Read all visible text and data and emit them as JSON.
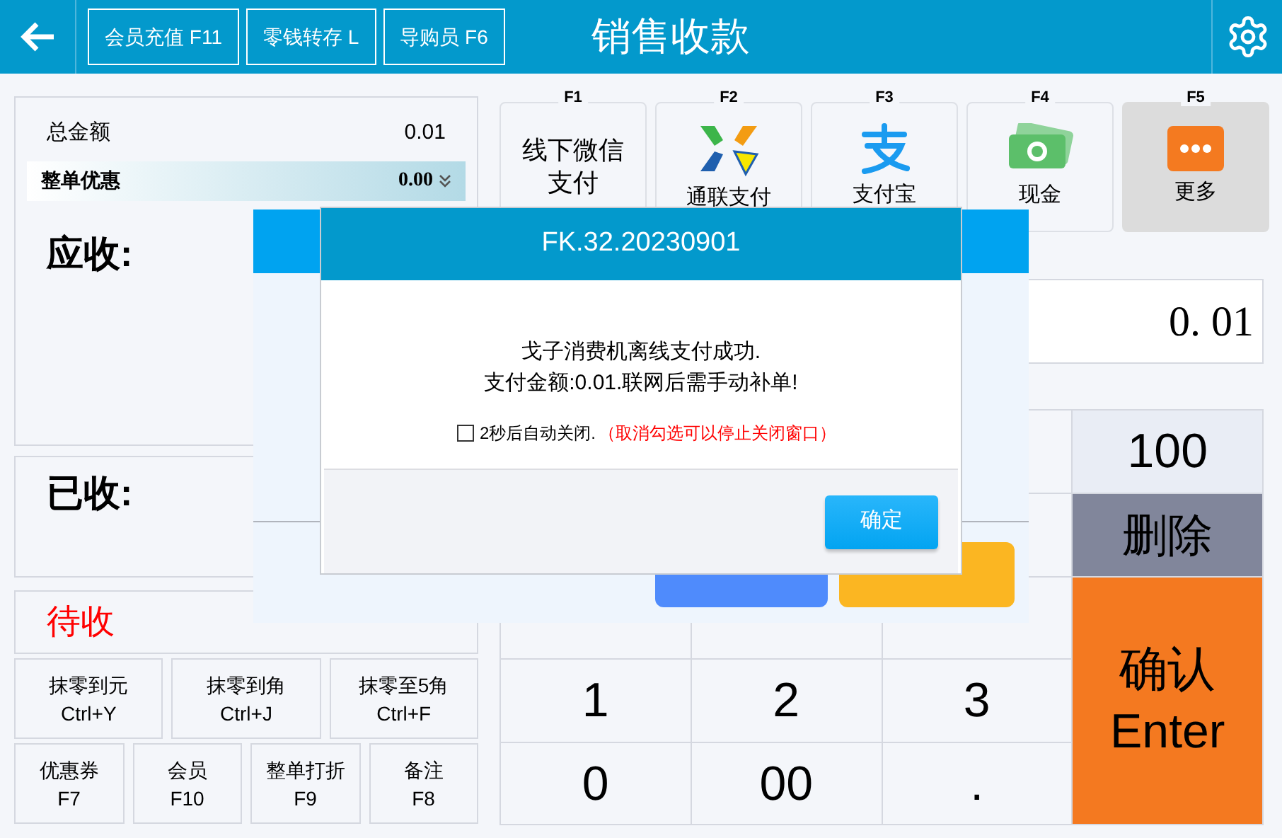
{
  "top_bar": {
    "buttons": [
      "会员充值 F11",
      "零钱转存 L",
      "导购员 F6"
    ],
    "title": "销售收款"
  },
  "summary": {
    "total_label": "总金额",
    "total_value": "0.01",
    "discount_label": "整单优惠",
    "discount_value": "0.00",
    "receivable_label": "应收:",
    "received_label": "已收:",
    "pending_label": "待收"
  },
  "rounding_buttons": [
    {
      "label": "抹零到元",
      "key": "Ctrl+Y"
    },
    {
      "label": "抹零到角",
      "key": "Ctrl+J"
    },
    {
      "label": "抹零至5角",
      "key": "Ctrl+F"
    }
  ],
  "function_buttons": [
    {
      "label": "优惠券",
      "key": "F7"
    },
    {
      "label": "会员",
      "key": "F10"
    },
    {
      "label": "整单打折",
      "key": "F9"
    },
    {
      "label": "备注",
      "key": "F8"
    }
  ],
  "payment_methods": [
    {
      "key": "F1",
      "label": "线下微信支付",
      "kind": "text",
      "selected": false
    },
    {
      "key": "F2",
      "label": "通联支付",
      "kind": "arrows",
      "selected": false
    },
    {
      "key": "F3",
      "label": "支付宝",
      "kind": "alipay",
      "selected": false
    },
    {
      "key": "F4",
      "label": "现金",
      "kind": "cash",
      "selected": false
    },
    {
      "key": "F5",
      "label": "更多",
      "kind": "more",
      "selected": true
    }
  ],
  "amount_field": {
    "value": "0. 01"
  },
  "numpad": [
    [
      {
        "kind": "preset",
        "label": "100"
      }
    ],
    [
      {
        "kind": "delete",
        "label": "删除"
      }
    ],
    [
      {
        "kind": "digit"
      },
      {
        "kind": "digit"
      },
      {
        "kind": "digit"
      },
      {
        "kind": "confirm",
        "label": "确认",
        "sublabel": "Enter"
      }
    ],
    [
      {
        "kind": "digit",
        "label": "1"
      },
      {
        "kind": "digit",
        "label": "2"
      },
      {
        "kind": "digit",
        "label": "3"
      }
    ],
    [
      {
        "kind": "digit",
        "label": "0"
      },
      {
        "kind": "digit",
        "label": "00"
      },
      {
        "kind": "digit",
        "label": "."
      }
    ]
  ],
  "back_panel": {
    "buttons": [
      {
        "kind": "primary"
      },
      {
        "kind": "cancel"
      }
    ]
  },
  "dialog": {
    "title": "FK.32.20230901",
    "message": [
      "戈子消费机离线支付成功.",
      "支付金额:0.01.联网后需手动补单!"
    ],
    "auto_close": {
      "label": "2秒后自动关闭.",
      "checked": false,
      "note": "（取消勾选可以停止关闭窗口）"
    },
    "ok": "确定"
  }
}
